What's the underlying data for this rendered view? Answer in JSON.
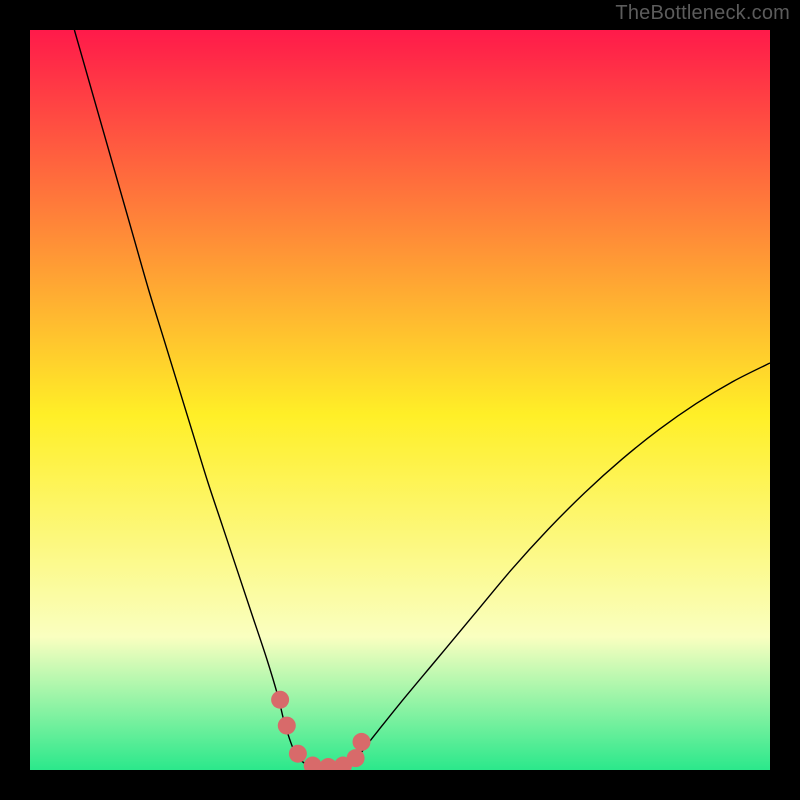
{
  "watermark": "TheBottleneck.com",
  "chart_data": {
    "type": "line",
    "title": "",
    "xlabel": "",
    "ylabel": "",
    "xlim": [
      0,
      100
    ],
    "ylim": [
      0,
      100
    ],
    "background_gradient": {
      "top_color": "#ff1a4a",
      "mid_color_upper": "#ffef27",
      "mid_color_lower": "#faffc0",
      "bottom_color": "#2be88b"
    },
    "series": [
      {
        "name": "bottleneck-curve",
        "color": "#000000",
        "stroke_width": 1.4,
        "x": [
          6,
          8,
          10,
          12,
          14,
          16,
          18,
          20,
          22,
          24,
          26,
          28,
          30,
          32,
          33.5,
          34.5,
          36,
          38,
          40,
          42,
          44,
          46,
          50,
          55,
          60,
          65,
          70,
          75,
          80,
          85,
          90,
          95,
          100
        ],
        "y": [
          100,
          93,
          86,
          79,
          72,
          65,
          58.5,
          52,
          45.5,
          39,
          33,
          27,
          21,
          15,
          10,
          6,
          2,
          0.5,
          0.3,
          0.5,
          1.5,
          4,
          9,
          15,
          21,
          27,
          32.5,
          37.5,
          42,
          46,
          49.5,
          52.5,
          55
        ]
      },
      {
        "name": "recommended-markers",
        "type": "scatter",
        "color": "#d86a6a",
        "marker_radius": 9,
        "x": [
          33.8,
          34.7,
          36.2,
          38.2,
          40.3,
          42.3,
          44.0,
          44.8
        ],
        "y": [
          9.5,
          6.0,
          2.2,
          0.6,
          0.4,
          0.6,
          1.6,
          3.8
        ]
      }
    ]
  }
}
